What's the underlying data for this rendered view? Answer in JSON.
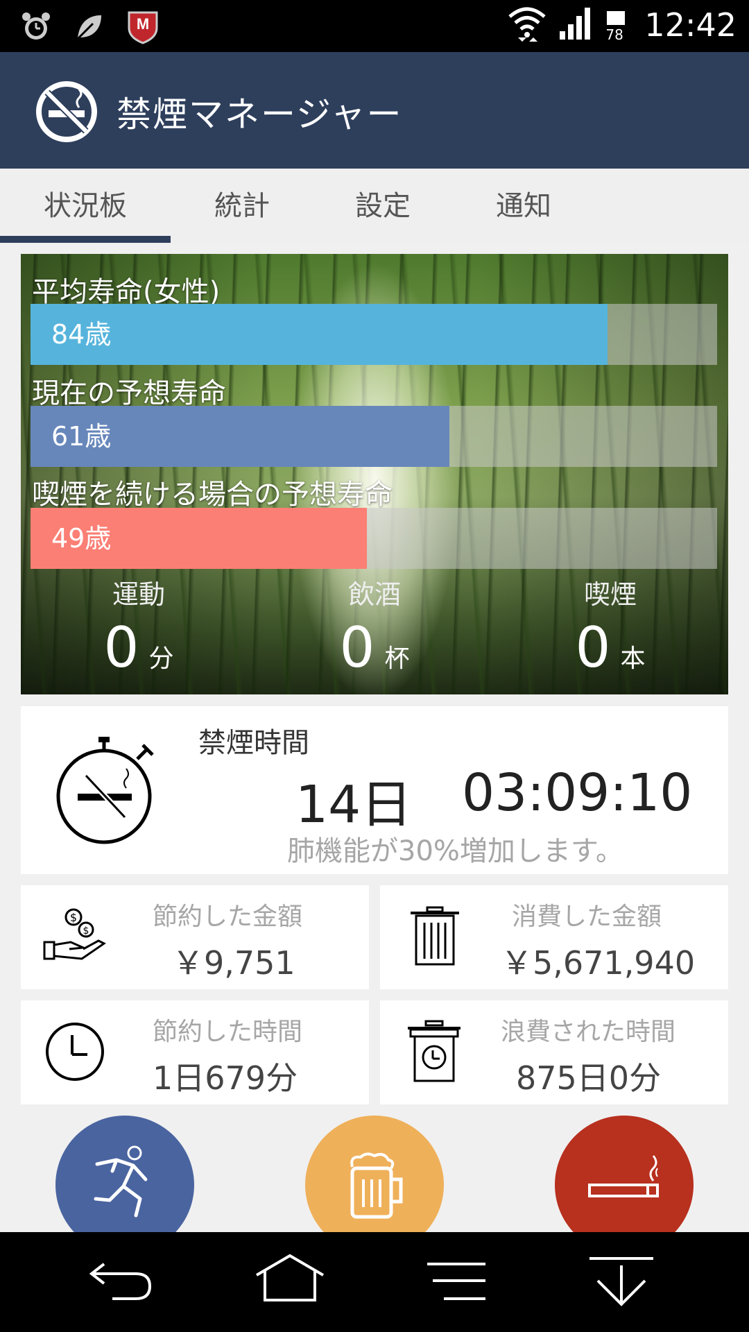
{
  "status_bar": {
    "time": "12:42",
    "battery_level": "78",
    "icons": [
      "alarm-icon",
      "leaf-icon",
      "mcafee-icon",
      "wifi-icon",
      "signal-icon",
      "battery-icon"
    ]
  },
  "app": {
    "title": "禁煙マネージャー",
    "primary_color": "#2e3f5c"
  },
  "tabs": [
    {
      "label": "状況板",
      "active": true
    },
    {
      "label": "統計",
      "active": false
    },
    {
      "label": "設定",
      "active": false
    },
    {
      "label": "通知",
      "active": false
    }
  ],
  "life_expectancy": {
    "scale_max_years": 100,
    "bars": [
      {
        "label": "平均寿命(女性)",
        "value": 84,
        "value_text": "84歳",
        "color": "#56b4dc"
      },
      {
        "label": "現在の予想寿命",
        "value": 61,
        "value_text": "61歳",
        "color": "#6787bb"
      },
      {
        "label": "喫煙を続ける場合の予想寿命",
        "value": 49,
        "value_text": "49歳",
        "color": "#fb7f75"
      }
    ]
  },
  "counters": [
    {
      "label": "運動",
      "value": "0",
      "unit": "分"
    },
    {
      "label": "飲酒",
      "value": "0",
      "unit": "杯"
    },
    {
      "label": "喫煙",
      "value": "0",
      "unit": "本"
    }
  ],
  "quit_time": {
    "label": "禁煙時間",
    "days": "14日",
    "clock": "03:09:10",
    "message": "肺機能が30%増加します。"
  },
  "stats": [
    {
      "label": "節約した金額",
      "value": "￥9,751",
      "icon": "money-hand-icon"
    },
    {
      "label": "消費した金額",
      "value": "￥5,671,940",
      "icon": "trash-can-icon"
    },
    {
      "label": "節約した時間",
      "value": "1日679分",
      "icon": "clock-icon"
    },
    {
      "label": "浪費された時間",
      "value": "875日0分",
      "icon": "trash-clock-icon"
    }
  ],
  "action_buttons": [
    {
      "name": "exercise",
      "color": "#4a64a0",
      "icon": "running-person-icon"
    },
    {
      "name": "drink",
      "color": "#efb05a",
      "icon": "beer-mug-icon"
    },
    {
      "name": "smoke",
      "color": "#b8301e",
      "icon": "cigarette-icon"
    }
  ]
}
